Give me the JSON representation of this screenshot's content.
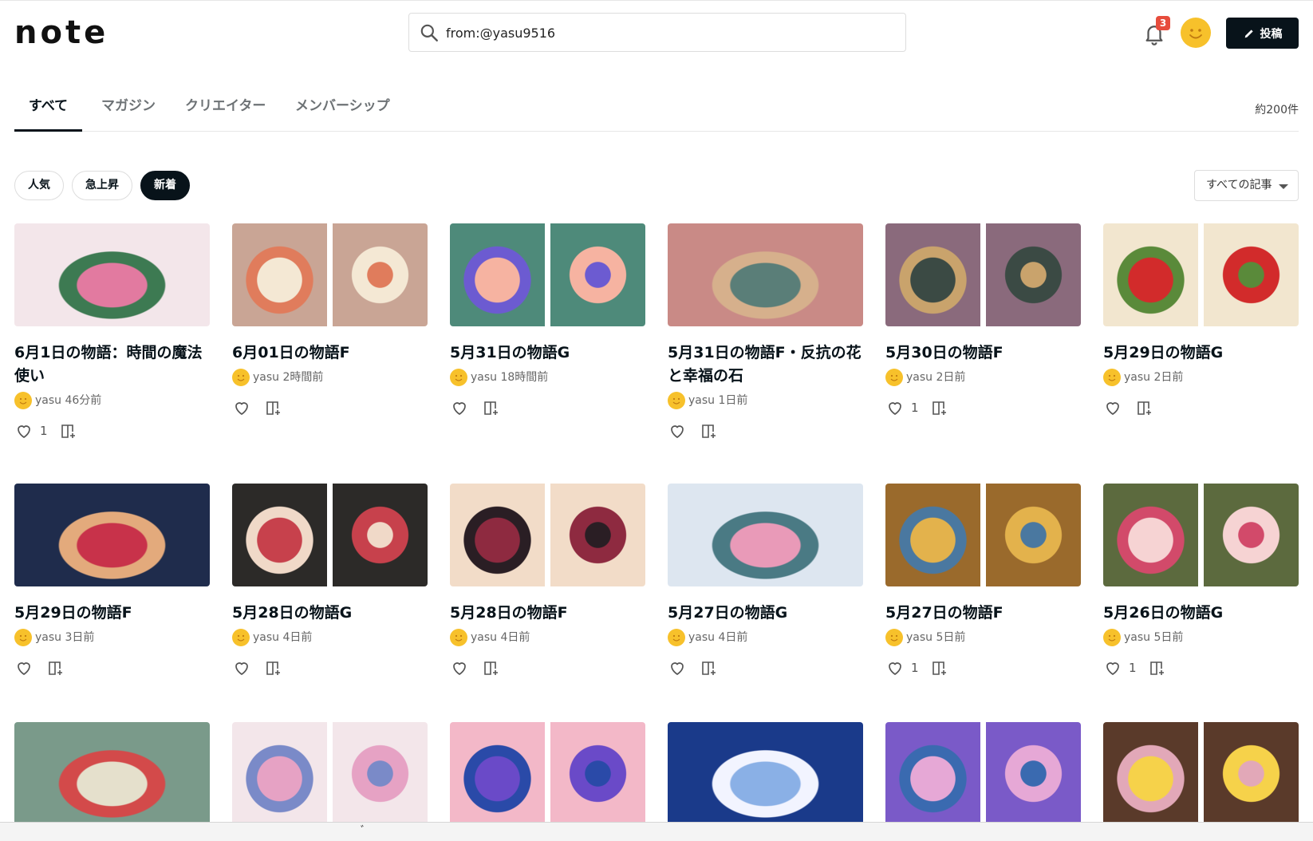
{
  "header": {
    "logo": "note",
    "search_value": "from:@yasu9516",
    "notification_count": "3",
    "post_label": "投稿"
  },
  "tabs": [
    {
      "label": "すべて",
      "active": true
    },
    {
      "label": "マガジン"
    },
    {
      "label": "クリエイター"
    },
    {
      "label": "メンバーシップ"
    }
  ],
  "result_count": "約200件",
  "filters": {
    "chips": [
      "人気",
      "急上昇",
      "新着"
    ],
    "active_chip": "新着",
    "sort_label": "すべての記事"
  },
  "articles": [
    {
      "title": "6月1日の物語：時間の魔法使い",
      "author": "yasu",
      "time": "46分前",
      "likes": "1",
      "colors": [
        "#f3e6ea",
        "#e27aa0",
        "#3d7a52"
      ]
    },
    {
      "title": "6月01日の物語F",
      "author": "yasu",
      "time": "2時間前",
      "likes": "",
      "colors": [
        "#c9a595",
        "#f4e8d4",
        "#e07c5c"
      ]
    },
    {
      "title": "5月31日の物語G",
      "author": "yasu",
      "time": "18時間前",
      "likes": "",
      "colors": [
        "#4e8a7a",
        "#f6b3a1",
        "#6c5bd1"
      ]
    },
    {
      "title": "5月31日の物語F・反抗の花と幸福の石",
      "author": "yasu",
      "time": "1日前",
      "likes": "",
      "colors": [
        "#c98a86",
        "#5a7e78",
        "#d6b08c"
      ]
    },
    {
      "title": "5月30日の物語F",
      "author": "yasu",
      "time": "2日前",
      "likes": "1",
      "colors": [
        "#8a6a7c",
        "#3b4a44",
        "#c9a36c"
      ]
    },
    {
      "title": "5月29日の物語G",
      "author": "yasu",
      "time": "2日前",
      "likes": "",
      "colors": [
        "#f2e6cf",
        "#d22b2b",
        "#5a8a3a"
      ]
    },
    {
      "title": "5月29日の物語F",
      "author": "yasu",
      "time": "3日前",
      "likes": "",
      "colors": [
        "#1f2c4c",
        "#c8324a",
        "#e3aa7c"
      ]
    },
    {
      "title": "5月28日の物語G",
      "author": "yasu",
      "time": "4日前",
      "likes": "",
      "colors": [
        "#2c2a28",
        "#c7414c",
        "#f0d9c8"
      ]
    },
    {
      "title": "5月28日の物語F",
      "author": "yasu",
      "time": "4日前",
      "likes": "",
      "colors": [
        "#f2dcc8",
        "#8e2a40",
        "#2a1e24"
      ]
    },
    {
      "title": "5月27日の物語G",
      "author": "yasu",
      "time": "4日前",
      "likes": "",
      "colors": [
        "#dde6f0",
        "#e99ab8",
        "#4a7a84"
      ]
    },
    {
      "title": "5月27日の物語F",
      "author": "yasu",
      "time": "5日前",
      "likes": "1",
      "colors": [
        "#9a6a2c",
        "#e3b24c",
        "#4a78a0"
      ]
    },
    {
      "title": "5月26日の物語G",
      "author": "yasu",
      "time": "5日前",
      "likes": "1",
      "colors": [
        "#5c6a3e",
        "#f6d3d3",
        "#d24a6a"
      ]
    },
    {
      "title": "",
      "author": "",
      "time": "",
      "likes": "",
      "colors": [
        "#7a9a8a",
        "#e5e0cc",
        "#d34a4a"
      ]
    },
    {
      "title": "",
      "author": "",
      "time": "",
      "likes": "",
      "colors": [
        "#f3e6ea",
        "#e6a2c4",
        "#7a8ac8"
      ]
    },
    {
      "title": "",
      "author": "",
      "time": "",
      "likes": "",
      "colors": [
        "#f3b8c8",
        "#6a4ac8",
        "#2a4aa8"
      ]
    },
    {
      "title": "",
      "author": "",
      "time": "",
      "likes": "",
      "colors": [
        "#1a3a8a",
        "#8ab0e6",
        "#f2f4ff"
      ]
    },
    {
      "title": "",
      "author": "",
      "time": "",
      "likes": "",
      "colors": [
        "#7a5ac8",
        "#e6a8d6",
        "#3a6ab0"
      ]
    },
    {
      "title": "",
      "author": "",
      "time": "",
      "likes": "",
      "colors": [
        "#5a3a2a",
        "#f6d24a",
        "#e2a8b8"
      ]
    }
  ],
  "bottom_text": "ﾞ"
}
